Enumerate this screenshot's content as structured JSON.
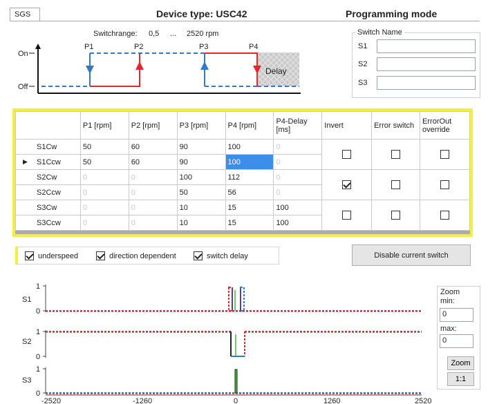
{
  "header": {
    "tab_label": "SGS",
    "device_type": "Device type: USC42",
    "mode": "Programming mode"
  },
  "switchrange": {
    "label": "Switchrange:",
    "min": "0,5",
    "ellipsis": "...",
    "max": "2520 rpm"
  },
  "diagram": {
    "on_label": "On",
    "off_label": "Off",
    "points": [
      "P1",
      "P2",
      "P3",
      "P4"
    ],
    "delay_label": "Delay",
    "colors": {
      "red": "#e8262a",
      "blue": "#2f79c7",
      "delay_bg": "#c8c8c8"
    }
  },
  "switch_name": {
    "title": "Switch Name",
    "labels": [
      "S1",
      "S2",
      "S3"
    ],
    "values": [
      "",
      "",
      ""
    ]
  },
  "table": {
    "columns": [
      "",
      "P1 [rpm]",
      "P2 [rpm]",
      "P3 [rpm]",
      "P4 [rpm]",
      "P4-Delay [ms]",
      "Invert",
      "Error switch",
      "ErrorOut override"
    ],
    "rows": [
      {
        "name": "S1Cw",
        "p1": "50",
        "p2": "60",
        "p3": "90",
        "p4": "100",
        "delay": "0",
        "current": false
      },
      {
        "name": "S1Ccw",
        "p1": "50",
        "p2": "60",
        "p3": "90",
        "p4": "100",
        "delay": "0",
        "current": true
      },
      {
        "name": "S2Cw",
        "p1": "0",
        "p2": "0",
        "p3": "100",
        "p4": "112",
        "delay": "0",
        "current": false
      },
      {
        "name": "S2Ccw",
        "p1": "0",
        "p2": "0",
        "p3": "50",
        "p4": "56",
        "delay": "0",
        "current": false
      },
      {
        "name": "S3Cw",
        "p1": "0",
        "p2": "0",
        "p3": "10",
        "p4": "15",
        "delay": "100",
        "current": false
      },
      {
        "name": "S3Ccw",
        "p1": "0",
        "p2": "0",
        "p3": "10",
        "p4": "15",
        "delay": "100",
        "current": false
      }
    ],
    "switch_flags": [
      {
        "invert": false,
        "error_switch": false,
        "errorout_override": false
      },
      {
        "invert": true,
        "error_switch": false,
        "errorout_override": false
      },
      {
        "invert": false,
        "error_switch": false,
        "errorout_override": false
      }
    ],
    "highlight_color": "#f6ef3a",
    "selection_color": "#3d8ee8"
  },
  "options": {
    "underspeed": {
      "label": "underspeed",
      "checked": true
    },
    "direction_dependent": {
      "label": "direction dependent",
      "checked": true
    },
    "switch_delay": {
      "label": "switch delay",
      "checked": true
    }
  },
  "disable_button": "Disable current switch",
  "plots": {
    "labels": [
      "S1",
      "S2",
      "S3"
    ],
    "y_ticks": [
      "1",
      "0"
    ],
    "x_ticks": [
      "-2520",
      "-1260",
      "0",
      "1260",
      "2520"
    ]
  },
  "zoom": {
    "title": "Zoom",
    "min_label": "min:",
    "min_value": "0",
    "max_label": "max:",
    "max_value": "0",
    "zoom_button": "Zoom",
    "reset_button": "1:1"
  }
}
